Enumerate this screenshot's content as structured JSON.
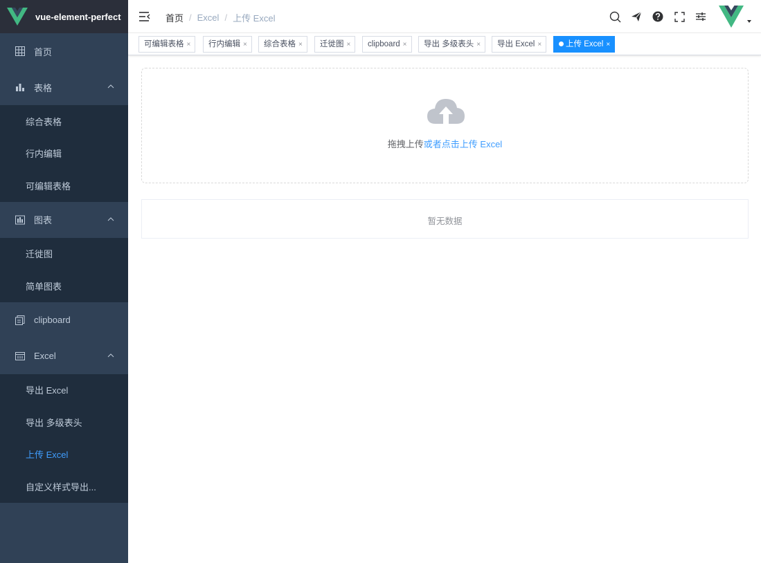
{
  "app": {
    "title": "vue-element-perfect"
  },
  "sidebar": {
    "home": {
      "label": "首页",
      "icon": "grid-icon"
    },
    "table": {
      "label": "表格",
      "icon": "bar-chart-icon",
      "children": [
        "综合表格",
        "行内编辑",
        "可编辑表格"
      ]
    },
    "chart": {
      "label": "图表",
      "icon": "chart-icon",
      "children": [
        "迁徙图",
        "简单图表"
      ]
    },
    "clipboard": {
      "label": "clipboard",
      "icon": "clipboard-icon"
    },
    "excel": {
      "label": "Excel",
      "icon": "excel-icon",
      "children": [
        "导出 Excel",
        "导出 多级表头",
        "上传 Excel",
        "自定义样式导出..."
      ],
      "active_index": 2
    }
  },
  "breadcrumb": [
    "首页",
    "Excel",
    "上传 Excel"
  ],
  "breadcrumb_separator": "/",
  "tags": [
    {
      "label": "可编辑表格",
      "active": false
    },
    {
      "label": "行内编辑",
      "active": false
    },
    {
      "label": "综合表格",
      "active": false
    },
    {
      "label": "迁徙图",
      "active": false
    },
    {
      "label": "clipboard",
      "active": false
    },
    {
      "label": "导出 多级表头",
      "active": false
    },
    {
      "label": "导出 Excel",
      "active": false
    },
    {
      "label": "上传 Excel",
      "active": true
    }
  ],
  "tag_close": "×",
  "upload": {
    "text_prefix": "拖拽上传",
    "text_link": "或者点击上传 Excel"
  },
  "table": {
    "empty_text": "暂无数据"
  },
  "colors": {
    "sidebar_bg": "#304156",
    "submenu_bg": "#1f2d3d",
    "active_text": "#409eff",
    "active_tag": "#1890ff",
    "vue_green": "#42b883",
    "vue_dark": "#35495e"
  }
}
